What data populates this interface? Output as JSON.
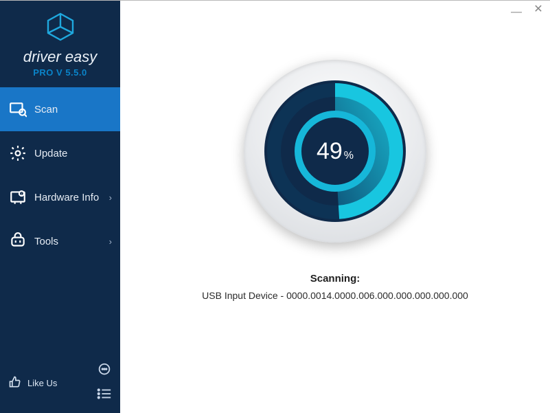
{
  "brand": {
    "name": "driver easy",
    "version": "PRO V 5.5.0"
  },
  "nav": {
    "scan": "Scan",
    "update": "Update",
    "hardware_info": "Hardware Info",
    "tools": "Tools"
  },
  "sidebar_bottom": {
    "like_us": "Like Us"
  },
  "scan": {
    "progress_value": "49",
    "progress_unit": "%",
    "status_label": "Scanning:",
    "status_detail": "USB Input Device - 0000.0014.0000.006.000.000.000.000.000"
  },
  "colors": {
    "sidebar_bg": "#0f2a4a",
    "accent": "#1976c7",
    "brand_blue": "#0a84c9",
    "ring": "#16b7d9"
  }
}
